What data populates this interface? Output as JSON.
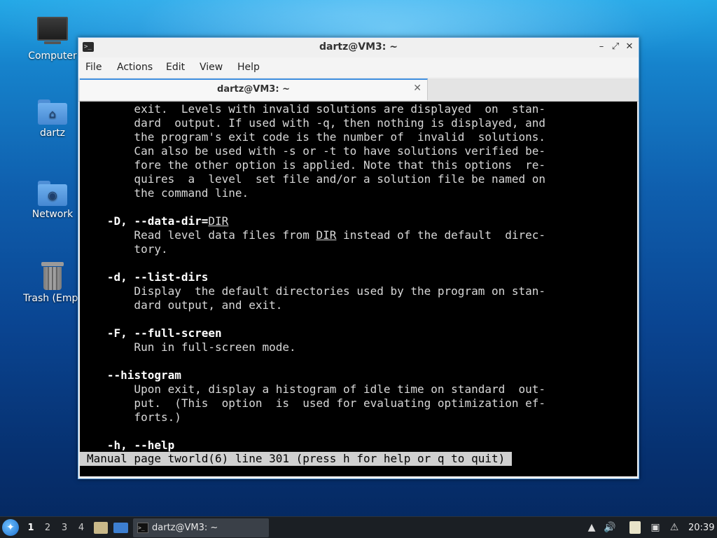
{
  "desktop": {
    "icons": [
      {
        "label": "Computer",
        "icon": "computer-icon"
      },
      {
        "label": "dartz",
        "icon": "home-folder-icon"
      },
      {
        "label": "Network",
        "icon": "network-folder-icon"
      },
      {
        "label": "Trash (Empt",
        "icon": "trash-icon"
      }
    ]
  },
  "window": {
    "title": "dartz@VM3: ~",
    "menu": [
      "File",
      "Actions",
      "Edit",
      "View",
      "Help"
    ],
    "tab_label": "dartz@VM3: ~"
  },
  "terminal": {
    "lines": [
      "       exit.  Levels with invalid solutions are displayed  on  stan-",
      "       dard  output. If used with -q, then nothing is displayed, and",
      "       the program's exit code is the number of  invalid  solutions.",
      "       Can also be used with -s or -t to have solutions verified be-",
      "       fore the other option is applied. Note that this options  re-",
      "       quires  a  level  set file and/or a solution file be named on",
      "       the command line.",
      "",
      "",
      "       Read level data files from ",
      "       tory.",
      "",
      "",
      "       Display  the default directories used by the program on stan-",
      "       dard output, and exit.",
      "",
      "",
      "       Run in full-screen mode.",
      "",
      "",
      "       Upon exit, display a histogram of idle time on standard  out-",
      "       put.  (This  option  is  used for evaluating optimization ef-",
      "       forts.)",
      "",
      ""
    ],
    "opt_data_dir": "-D, --data-dir=",
    "opt_data_dir_arg": "DIR",
    "data_dir_mid_arg": "DIR",
    "data_dir_tail": " instead of the default  direc-",
    "opt_list_dirs": "-d, --list-dirs",
    "opt_full_screen": "-F, --full-screen",
    "opt_histogram": "--histogram",
    "opt_help": "-h, --help",
    "status": "Manual page tworld(6) line 301 (press h for help or q to quit)"
  },
  "taskbar": {
    "workspaces": [
      "1",
      "2",
      "3",
      "4"
    ],
    "active_workspace": "1",
    "task_label": "dartz@VM3: ~",
    "clock": "20:39"
  }
}
